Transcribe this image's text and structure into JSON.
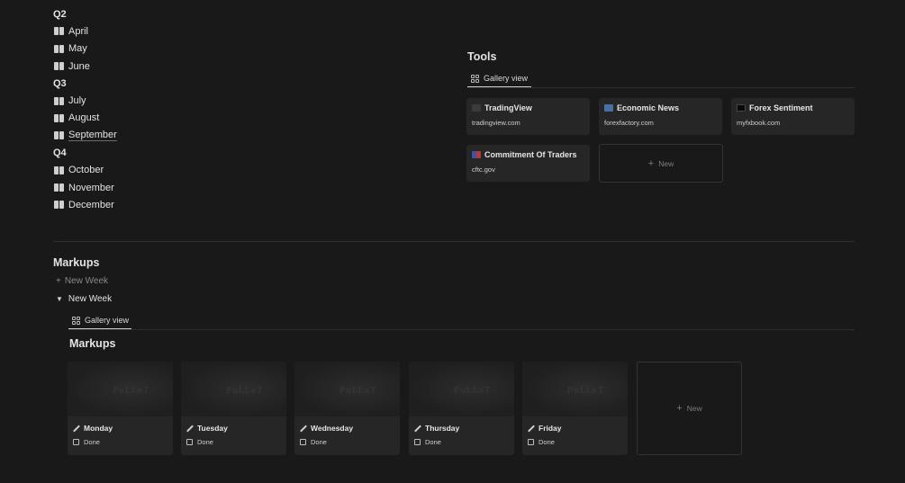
{
  "months": {
    "q2": "Q2",
    "q3": "Q3",
    "q4": "Q4",
    "april": "April",
    "may": "May",
    "june": "June",
    "july": "July",
    "august": "August",
    "september": "September",
    "october": "October",
    "november": "November",
    "december": "December"
  },
  "tools": {
    "title": "Tools",
    "view_tab": "Gallery view",
    "cards": [
      {
        "title": "TradingView",
        "url": "tradingview.com"
      },
      {
        "title": "Economic News",
        "url": "forexfactory.com"
      },
      {
        "title": "Forex Sentiment",
        "url": "myfxbook.com"
      },
      {
        "title": "Commitment Of Traders",
        "url": "cftc.gov"
      }
    ],
    "new_label": "New"
  },
  "markups": {
    "title": "Markups",
    "new_week_button": "New Week",
    "toggle_label": "New Week",
    "view_tab": "Gallery view",
    "gallery_title": "Markups",
    "days": [
      {
        "name": "Monday",
        "done": "Done"
      },
      {
        "name": "Tuesday",
        "done": "Done"
      },
      {
        "name": "Wednesday",
        "done": "Done"
      },
      {
        "name": "Thursday",
        "done": "Done"
      },
      {
        "name": "Friday",
        "done": "Done"
      }
    ],
    "cover_watermark": "PuLLeT",
    "new_label": "New"
  },
  "icons": {
    "month": "book-icon",
    "view": "gallery-grid-icon",
    "day": "pencil-icon",
    "checkbox": "checkbox-icon"
  },
  "colors": {
    "background": "#191919",
    "card": "#262626",
    "text": "#e3e3e3"
  }
}
